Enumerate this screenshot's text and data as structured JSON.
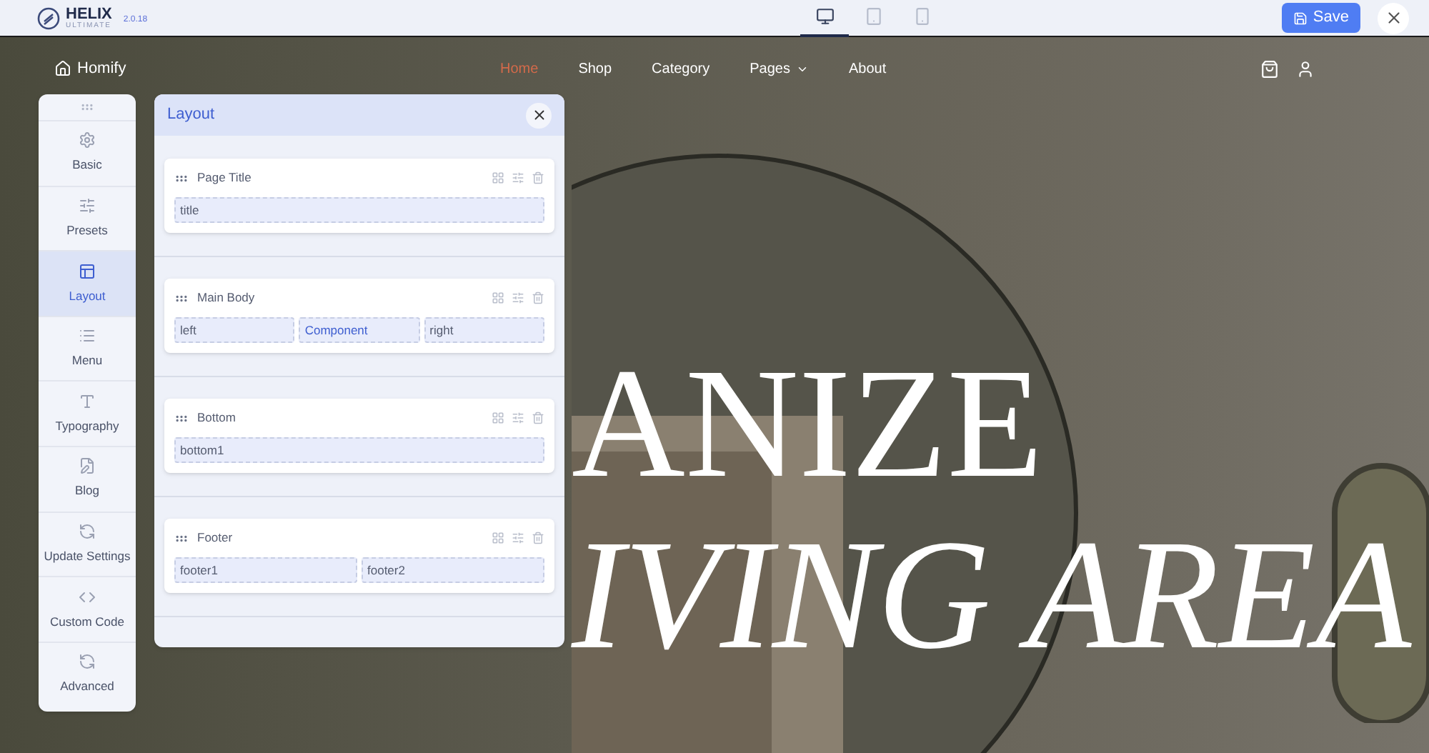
{
  "toolbar": {
    "logo": "HELIX",
    "logo_sub": "ULTIMATE",
    "version": "2.0.18",
    "devices": [
      {
        "kind": "desktop",
        "selected": true
      },
      {
        "kind": "tablet",
        "selected": false
      },
      {
        "kind": "phone",
        "selected": false
      }
    ],
    "save": "Save"
  },
  "site": {
    "brand": "Homify",
    "nav": [
      {
        "label": "Home",
        "selected": true,
        "dropdown": false
      },
      {
        "label": "Shop",
        "selected": false,
        "dropdown": false
      },
      {
        "label": "Category",
        "selected": false,
        "dropdown": false
      },
      {
        "label": "Pages",
        "selected": false,
        "dropdown": true
      },
      {
        "label": "About",
        "selected": false,
        "dropdown": false
      }
    ],
    "hero": [
      "ANIZE",
      "IVING AREA"
    ]
  },
  "sidebar": [
    {
      "kind": "gear",
      "label": "Basic",
      "selected": false
    },
    {
      "kind": "sliders",
      "label": "Presets",
      "selected": false
    },
    {
      "kind": "layout",
      "label": "Layout",
      "selected": true
    },
    {
      "kind": "menu",
      "label": "Menu",
      "selected": false
    },
    {
      "kind": "type",
      "label": "Typography",
      "selected": false
    },
    {
      "kind": "blog",
      "label": "Blog",
      "selected": false
    },
    {
      "kind": "update",
      "label": "Update Settings",
      "selected": false
    },
    {
      "kind": "code",
      "label": "Custom Code",
      "selected": false
    },
    {
      "kind": "update",
      "label": "Advanced",
      "selected": false
    }
  ],
  "panel": {
    "title": "Layout",
    "rows": [
      {
        "title": "Page Title",
        "columns": [
          {
            "label": "title",
            "kind": "position"
          }
        ]
      },
      {
        "title": "Main Body",
        "columns": [
          {
            "label": "left",
            "kind": "position"
          },
          {
            "label": "Component",
            "kind": "component"
          },
          {
            "label": "right",
            "kind": "position"
          }
        ]
      },
      {
        "title": "Bottom",
        "columns": [
          {
            "label": "bottom1",
            "kind": "position"
          }
        ]
      },
      {
        "title": "Footer",
        "columns": [
          {
            "label": "footer1",
            "kind": "position"
          },
          {
            "label": "footer2",
            "kind": "position"
          }
        ]
      }
    ]
  }
}
